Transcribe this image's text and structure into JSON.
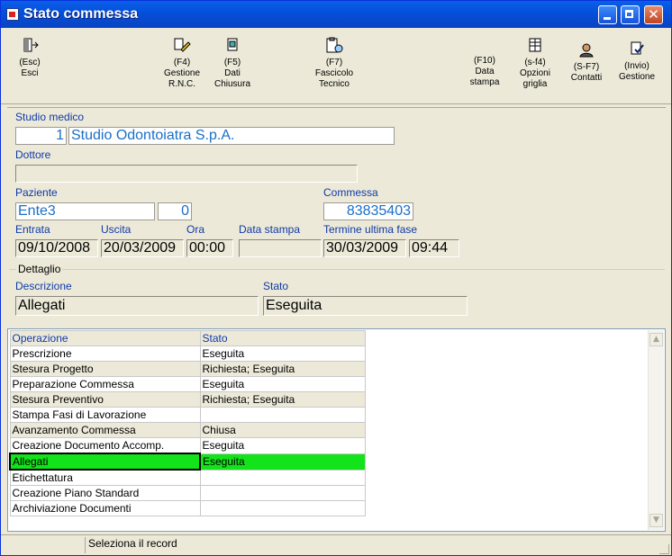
{
  "window": {
    "title": "Stato commessa"
  },
  "toolbar": {
    "esci": {
      "key": "(Esc)",
      "label": "Esci"
    },
    "gestione_rnc": {
      "key": "(F4)",
      "label1": "Gestione",
      "label2": "R.N.C."
    },
    "dati_chiusura": {
      "key": "(F5)",
      "label1": "Dati",
      "label2": "Chiusura"
    },
    "fascicolo": {
      "key": "(F7)",
      "label1": "Fascicolo",
      "label2": "Tecnico"
    },
    "data_stampa": {
      "key": "(F10)",
      "label1": "Data",
      "label2": "stampa"
    },
    "opzioni": {
      "key": "(s-f4)",
      "label1": "Opzioni",
      "label2": "griglia"
    },
    "contatti": {
      "key": "(S-F7)",
      "label": "Contatti"
    },
    "gestione": {
      "key": "(Invio)",
      "label": "Gestione"
    }
  },
  "form": {
    "studio_label": "Studio medico",
    "studio_code": "1",
    "studio_name": "Studio Odontoiatra S.p.A.",
    "dottore_label": "Dottore",
    "dottore_value": "",
    "paziente_label": "Paziente",
    "paziente_value": "Ente3",
    "paziente_code": "0",
    "commessa_label": "Commessa",
    "commessa_value": "83835403",
    "entrata_label": "Entrata",
    "entrata_value": "09/10/2008",
    "uscita_label": "Uscita",
    "uscita_value": "20/03/2009",
    "ora_label": "Ora",
    "ora_value": "00:00",
    "data_stampa_label": "Data stampa",
    "data_stampa_value": "",
    "termine_label": "Termine ultima fase",
    "termine_date": "30/03/2009",
    "termine_time": "09:44"
  },
  "dettaglio": {
    "legend": "Dettaglio",
    "descrizione_label": "Descrizione",
    "descrizione_value": "Allegati",
    "stato_label": "Stato",
    "stato_value": "Eseguita"
  },
  "grid": {
    "headers": [
      "Operazione",
      "Stato"
    ],
    "rows": [
      [
        "Prescrizione",
        "Eseguita"
      ],
      [
        "Stesura Progetto",
        "Richiesta; Eseguita"
      ],
      [
        "Preparazione Commessa",
        "Eseguita"
      ],
      [
        "Stesura Preventivo",
        "Richiesta; Eseguita"
      ],
      [
        "Stampa Fasi di Lavorazione",
        ""
      ],
      [
        "Avanzamento Commessa",
        "Chiusa"
      ],
      [
        "Creazione Documento Accomp.",
        "Eseguita"
      ],
      [
        "Allegati",
        "Eseguita"
      ],
      [
        "Etichettatura",
        ""
      ],
      [
        "Creazione Piano Standard",
        ""
      ],
      [
        "Archiviazione Documenti",
        ""
      ]
    ],
    "selected_index": 7,
    "selected_color": "#12e31a"
  },
  "statusbar": {
    "text": "Seleziona il record"
  },
  "colors": {
    "titlebar": "#0550dc",
    "label": "#0f3aa8",
    "field_text": "#1a6fc7"
  }
}
